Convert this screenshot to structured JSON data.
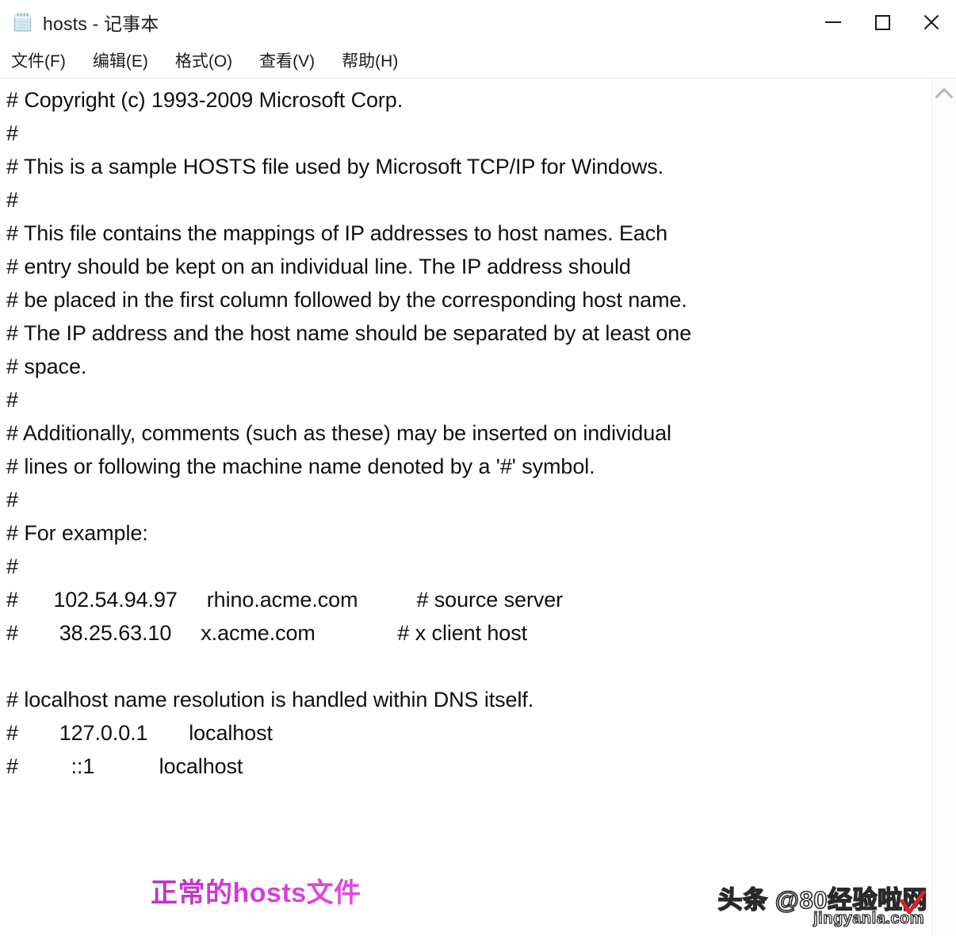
{
  "window": {
    "title": "hosts - 记事本",
    "icon": "notepad-icon",
    "controls": {
      "minimize": "—",
      "maximize": "▢",
      "close": "✕"
    }
  },
  "menubar": {
    "items": [
      {
        "label": "文件(F)",
        "name": "menu-file"
      },
      {
        "label": "编辑(E)",
        "name": "menu-edit"
      },
      {
        "label": "格式(O)",
        "name": "menu-format"
      },
      {
        "label": "查看(V)",
        "name": "menu-view"
      },
      {
        "label": "帮助(H)",
        "name": "menu-help"
      }
    ]
  },
  "editor": {
    "content": "# Copyright (c) 1993-2009 Microsoft Corp.\n#\n# This is a sample HOSTS file used by Microsoft TCP/IP for Windows.\n#\n# This file contains the mappings of IP addresses to host names. Each\n# entry should be kept on an individual line. The IP address should\n# be placed in the first column followed by the corresponding host name.\n# The IP address and the host name should be separated by at least one\n# space.\n#\n# Additionally, comments (such as these) may be inserted on individual\n# lines or following the machine name denoted by a '#' symbol.\n#\n# For example:\n#\n#      102.54.94.97     rhino.acme.com          # source server\n#       38.25.63.10     x.acme.com              # x client host\n\n# localhost name resolution is handled within DNS itself.\n#       127.0.0.1       localhost\n#         ::1           localhost",
    "lines": [
      "# Copyright (c) 1993-2009 Microsoft Corp.",
      "#",
      "# This is a sample HOSTS file used by Microsoft TCP/IP for Windows.",
      "#",
      "# This file contains the mappings of IP addresses to host names. Each",
      "# entry should be kept on an individual line. The IP address should",
      "# be placed in the first column followed by the corresponding host name.",
      "# The IP address and the host name should be separated by at least one",
      "# space.",
      "#",
      "# Additionally, comments (such as these) may be inserted on individual",
      "# lines or following the machine name denoted by a '#' symbol.",
      "#",
      "# For example:",
      "#",
      "#      102.54.94.97     rhino.acme.com          # source server",
      "#       38.25.63.10     x.acme.com              # x client host",
      "",
      "# localhost name resolution is handled within DNS itself.",
      "#       127.0.0.1       localhost",
      "#         ::1           localhost"
    ],
    "host_entries": [
      {
        "ip": "102.54.94.97",
        "host": "rhino.acme.com",
        "comment": "# source server"
      },
      {
        "ip": "38.25.63.10",
        "host": "x.acme.com",
        "comment": "# x client host"
      },
      {
        "ip": "127.0.0.1",
        "host": "localhost",
        "comment": ""
      },
      {
        "ip": "::1",
        "host": "localhost",
        "comment": ""
      }
    ]
  },
  "scrollbar": {
    "up_arrow": "scroll-up-arrow",
    "position": "top"
  },
  "annotation": {
    "text": "正常的hosts文件",
    "color": "#cc33cc"
  },
  "watermark": {
    "main": "头条 @80经验啦网",
    "sub": "jingyanla.com",
    "check_color": "#d8232a"
  }
}
